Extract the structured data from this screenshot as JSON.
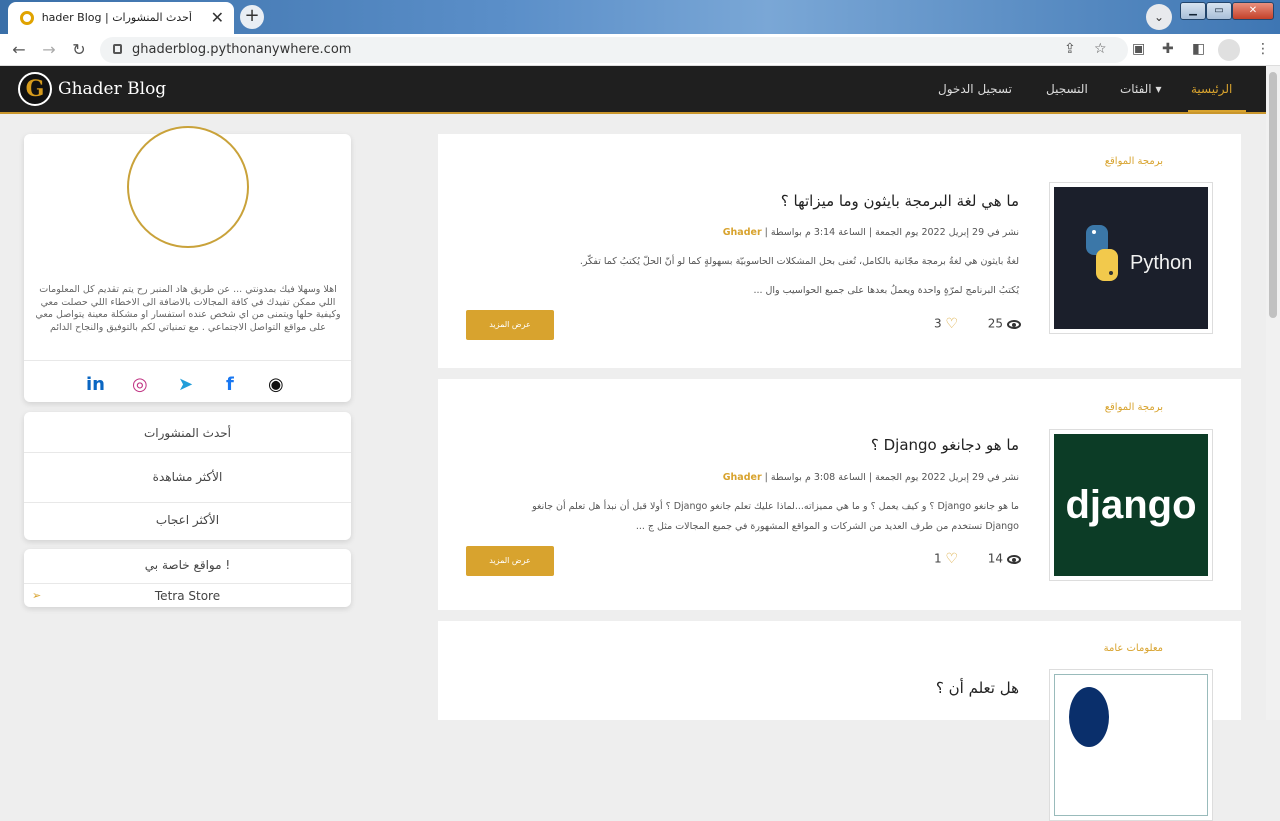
{
  "browser": {
    "tab_title": "أحدث المنشورات | Ghader Blog",
    "url": "ghaderblog.pythonanywhere.com",
    "new_tab": "+",
    "close_tab": "✕"
  },
  "site": {
    "brand": "Ghader Blog",
    "logo_letter": "G",
    "nav": [
      {
        "label": "الرئيسية",
        "active": true
      },
      {
        "label": "الفئات ▾",
        "active": false
      },
      {
        "label": "التسجيل",
        "active": false
      },
      {
        "label": "تسجيل الدخول",
        "active": false
      }
    ]
  },
  "sidebar": {
    "bio": "اهلا وسهلا فيك بمدونتي ... عن طريق هاد المنبر رح يتم تقديم كل المعلومات اللي ممكن تفيدك في كافة المجالات بالاضافة الى الاخطاء اللي حصلت معي وكيفية حلها ويتمنى من اي شخص عنده استفسار او مشكلة معينة يتواصل معي على مواقع التواصل الاجتماعي . مع تمنياتي لكم بالتوفيق والنجاح الدائم",
    "social": [
      "in",
      "◎",
      "➤",
      "f",
      "◉"
    ],
    "menu": [
      "أحدث المنشورات",
      "الأكثر مشاهدة",
      "الأكثر اعجاب"
    ],
    "sites_title": "مواقع خاصة بي !",
    "sites": [
      "Tetra Store"
    ]
  },
  "posts": [
    {
      "category": "برمجة المواقع",
      "title": "ما هي لغة البرمجة بايثون وما ميزاتها ؟",
      "meta": "نشر في 29 إبريل 2022 يوم الجمعة | الساعة 3:14 م بواسطة |",
      "author": "Ghader",
      "excerpt_1": "لغةُ بايثون هي لغةُ برمجة مجّانية بالكامل، تُعنى بحل المشكلات الحاسوبيّة بسهولةٍ كما لو أنّ الحلّ يُكتبُ كما تفكّر.",
      "excerpt_2": "يُكتبُ البرنامج لمرّةٍ واحدة ويعملُ بعدها على جميع الحواسيب وال ...",
      "button": "عرض المزيد",
      "views": "25",
      "likes": "3",
      "image_text": "Python"
    },
    {
      "category": "برمجة المواقع",
      "title": "ما هو دجانغو Django ؟",
      "meta": "نشر في 29 إبريل 2022 يوم الجمعة | الساعة 3:08 م بواسطة |",
      "author": "Ghader",
      "excerpt_1": "ما هو جانغو Django ؟ و كيف يعمل ؟ و ما هي مميزاته...لماذا عليك تعلم جانغو Django ؟ أولا قبل أن نبدأ هل تعلم أن جانغو",
      "excerpt_2": "Django تستخدم من طرف العديد من الشركات و المواقع المشهورة في جميع المجالات مثل ج ...",
      "button": "عرض المزيد",
      "views": "14",
      "likes": "1",
      "image_text": "django"
    },
    {
      "category": "معلومات عامة",
      "title": "هل تعلم أن ؟"
    }
  ],
  "colors": {
    "accent": "#d8a32e",
    "navbar": "#1f1f1f",
    "django_bg": "#0c3c26",
    "python_bg": "#1b1f2b"
  }
}
